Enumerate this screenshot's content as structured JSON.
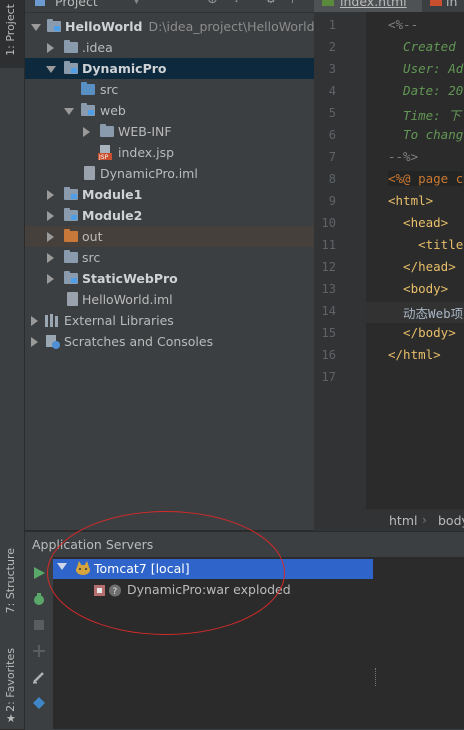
{
  "left_strip": {
    "project_tab": "1: Project",
    "structure_tab": "7: Structure",
    "favorites_tab": "2: Favorites"
  },
  "project_panel": {
    "title": "Project",
    "tree": [
      {
        "label": "HelloWorld",
        "path": "D:\\idea_project\\HelloWorld"
      },
      {
        "label": ".idea"
      },
      {
        "label": "DynamicPro"
      },
      {
        "label": "src"
      },
      {
        "label": "web"
      },
      {
        "label": "WEB-INF"
      },
      {
        "label": "index.jsp"
      },
      {
        "label": "DynamicPro.iml"
      },
      {
        "label": "Module1"
      },
      {
        "label": "Module2"
      },
      {
        "label": "out"
      },
      {
        "label": "src"
      },
      {
        "label": "StaticWebPro"
      },
      {
        "label": "HelloWorld.iml"
      },
      {
        "label": "External Libraries"
      },
      {
        "label": "Scratches and Consoles"
      }
    ]
  },
  "editor": {
    "tabs": [
      "index.html",
      "in"
    ],
    "line_numbers": [
      "1",
      "2",
      "3",
      "4",
      "5",
      "6",
      "7",
      "8",
      "9",
      "10",
      "11",
      "12",
      "13",
      "14",
      "15",
      "16",
      "17"
    ],
    "lines": [
      "<%--",
      "  Created",
      "  User: Ad",
      "  Date: 20",
      "  Time: 下",
      "  To chang",
      "--%>",
      "<%@ page c",
      "<html>",
      "  <head>",
      "    <title",
      "  </head>",
      "  <body>",
      "  动态Web项",
      "  </body>",
      "</html>",
      ""
    ],
    "breadcrumb": [
      "html",
      "body"
    ]
  },
  "app_servers": {
    "title": "Application Servers",
    "server": "Tomcat7 [local]",
    "artifact": "DynamicPro:war exploded"
  },
  "colors": {
    "selection": "#2f65ca",
    "annotation": "#d42a2a"
  }
}
